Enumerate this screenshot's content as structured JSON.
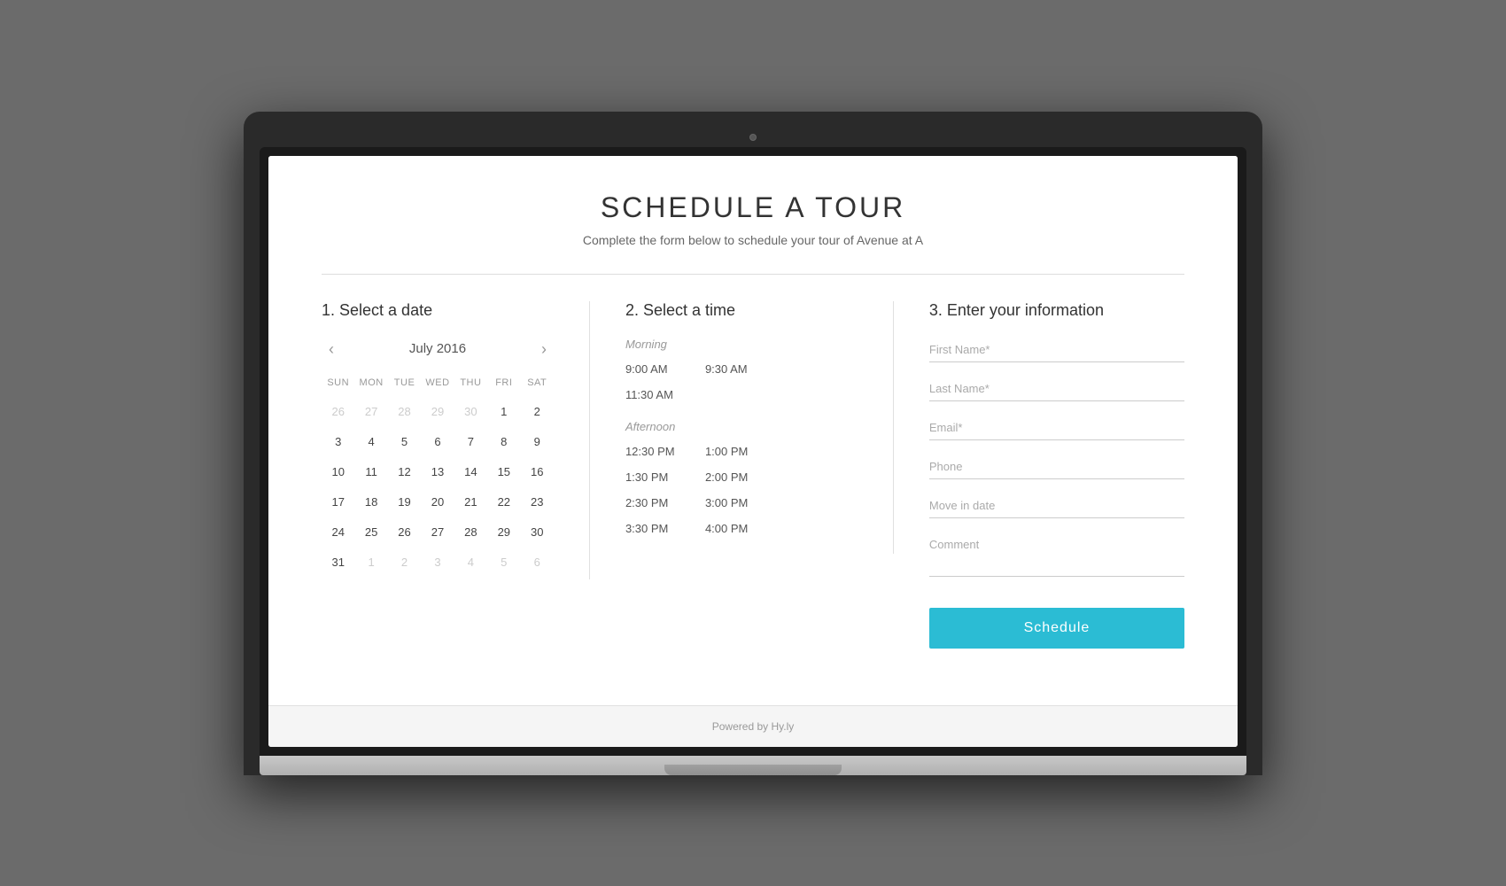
{
  "header": {
    "title": "SCHEDULE A TOUR",
    "subtitle": "Complete the form below to schedule your tour of Avenue at A"
  },
  "section1": {
    "heading": "1. Select a date",
    "calendar": {
      "month_year": "July 2016",
      "prev_label": "‹",
      "next_label": "›",
      "day_headers": [
        "SUN",
        "MON",
        "TUE",
        "WED",
        "THU",
        "FRI",
        "SAT"
      ],
      "weeks": [
        [
          {
            "day": "26",
            "other": true
          },
          {
            "day": "27",
            "other": true
          },
          {
            "day": "28",
            "other": true
          },
          {
            "day": "29",
            "other": true
          },
          {
            "day": "30",
            "other": true
          },
          {
            "day": "1",
            "other": false
          },
          {
            "day": "2",
            "other": false
          }
        ],
        [
          {
            "day": "3",
            "other": false
          },
          {
            "day": "4",
            "other": false
          },
          {
            "day": "5",
            "other": false
          },
          {
            "day": "6",
            "other": false
          },
          {
            "day": "7",
            "other": false
          },
          {
            "day": "8",
            "other": false
          },
          {
            "day": "9",
            "other": false
          }
        ],
        [
          {
            "day": "10",
            "other": false
          },
          {
            "day": "11",
            "other": false
          },
          {
            "day": "12",
            "other": false
          },
          {
            "day": "13",
            "other": false
          },
          {
            "day": "14",
            "other": false
          },
          {
            "day": "15",
            "other": false
          },
          {
            "day": "16",
            "other": false
          }
        ],
        [
          {
            "day": "17",
            "other": false
          },
          {
            "day": "18",
            "other": false
          },
          {
            "day": "19",
            "other": false
          },
          {
            "day": "20",
            "other": false
          },
          {
            "day": "21",
            "other": false
          },
          {
            "day": "22",
            "other": false
          },
          {
            "day": "23",
            "other": false
          }
        ],
        [
          {
            "day": "24",
            "other": false
          },
          {
            "day": "25",
            "other": false
          },
          {
            "day": "26",
            "other": false
          },
          {
            "day": "27",
            "other": false
          },
          {
            "day": "28",
            "other": false
          },
          {
            "day": "29",
            "other": false
          },
          {
            "day": "30",
            "other": false
          }
        ],
        [
          {
            "day": "31",
            "other": false
          },
          {
            "day": "1",
            "other": true
          },
          {
            "day": "2",
            "other": true
          },
          {
            "day": "3",
            "other": true
          },
          {
            "day": "4",
            "other": true
          },
          {
            "day": "5",
            "other": true
          },
          {
            "day": "6",
            "other": true
          }
        ]
      ]
    }
  },
  "section2": {
    "heading": "2. Select a time",
    "morning_label": "Morning",
    "afternoon_label": "Afternoon",
    "morning_slots": [
      {
        "col1": "9:00 AM",
        "col2": "9:30 AM"
      },
      {
        "col1": "11:30 AM",
        "col2": ""
      }
    ],
    "afternoon_slots": [
      {
        "col1": "12:30 PM",
        "col2": "1:00 PM"
      },
      {
        "col1": "1:30 PM",
        "col2": "2:00 PM"
      },
      {
        "col1": "2:30 PM",
        "col2": "3:00 PM"
      },
      {
        "col1": "3:30 PM",
        "col2": "4:00 PM"
      }
    ]
  },
  "section3": {
    "heading": "3. Enter your information",
    "fields": {
      "first_name_placeholder": "First Name*",
      "last_name_placeholder": "Last Name*",
      "email_placeholder": "Email*",
      "phone_placeholder": "Phone",
      "move_in_placeholder": "Move in date",
      "comment_placeholder": "Comment"
    },
    "submit_label": "Schedule"
  },
  "footer": {
    "powered_by": "Powered by Hy.ly"
  }
}
